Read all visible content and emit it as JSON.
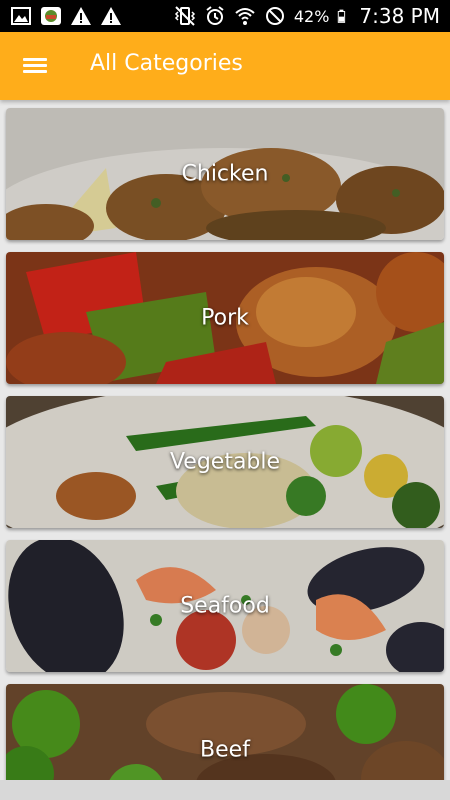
{
  "status_bar": {
    "battery": "42%",
    "time": "7:38 PM"
  },
  "app_bar": {
    "title": "All Categories",
    "accent_color": "#ffad1a"
  },
  "categories": [
    {
      "label": "Chicken"
    },
    {
      "label": "Pork"
    },
    {
      "label": "Vegetable"
    },
    {
      "label": "Seafood"
    },
    {
      "label": "Beef"
    }
  ]
}
